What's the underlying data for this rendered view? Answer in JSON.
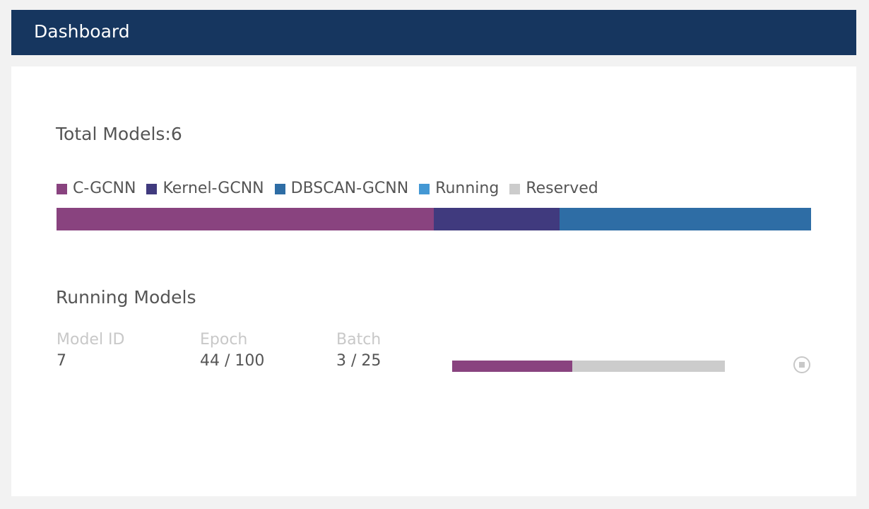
{
  "header": {
    "title": "Dashboard"
  },
  "summary": {
    "total_label": "Total Models:6",
    "legend": [
      {
        "label": "C-GCNN",
        "color": "#89437f"
      },
      {
        "label": "Kernel-GCNN",
        "color": "#403a7e"
      },
      {
        "label": "DBSCAN-GCNN",
        "color": "#2e6da5"
      },
      {
        "label": "Running",
        "color": "#4498d4"
      },
      {
        "label": "Reserved",
        "color": "#cccccc"
      }
    ],
    "bar_segments": [
      {
        "model": "C-GCNN",
        "count": 3,
        "color": "#89437f"
      },
      {
        "model": "Kernel-GCNN",
        "count": 1,
        "color": "#403a7e"
      },
      {
        "model": "DBSCAN-GCNN",
        "count": 2,
        "color": "#2e6da5"
      }
    ]
  },
  "running": {
    "title": "Running Models",
    "columns": {
      "model_id": "Model ID",
      "epoch": "Epoch",
      "batch": "Batch"
    },
    "rows": [
      {
        "model_id": "7",
        "epoch": "44 / 100",
        "batch": "3 / 25",
        "progress": 0.44,
        "progress_color": "#89437f",
        "track_color": "#cccccc",
        "action_icon": "stop-circle-icon"
      }
    ]
  }
}
